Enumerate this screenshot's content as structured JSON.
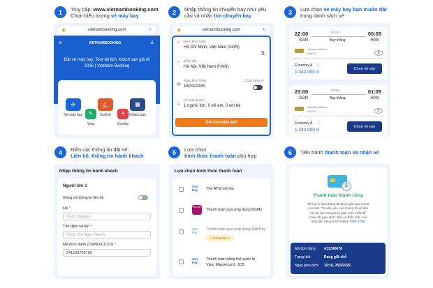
{
  "steps": [
    {
      "n": "1",
      "l1a": "Truy cập: ",
      "l1b": "www.vietnambooking.com",
      "l2a": "Chọn biểu tượng ",
      "l2b": "vé máy bay"
    },
    {
      "n": "2",
      "l1": "Nhập thông tin chuyến bay như yêu",
      "l2a": "cầu và nhấn ",
      "l2b": "tìm chuyến bay"
    },
    {
      "n": "3",
      "l1a": "Lựa chọn ",
      "l1b": "vé máy bay bạn muốn đặt",
      "l2": "trong danh sách vé"
    },
    {
      "n": "4",
      "l1": "Điền các thông tin đặt vé:",
      "l2": "Liên hệ, thông tin hành khách"
    },
    {
      "n": "5",
      "l1": "Lựa chọn",
      "l2a": "hình thức thanh toán",
      "l2b": " phù hợp"
    },
    {
      "n": "6",
      "l1a": "Tiến hành ",
      "l1b": "thanh toán và nhận vé"
    }
  ],
  "s1": {
    "url": "vietnambooking.com",
    "logo": "VIETNAMBOOKING",
    "banner1": "Đặt vé máy bay, Tour du lịch, khách sạn giá rẻ",
    "banner2": "2026 | VietNam Booking",
    "icons": [
      {
        "label": "Vé máy bay",
        "color": "#1a66d9"
      },
      {
        "label": "Du lịch",
        "color": "#e05a2a"
      },
      {
        "label": "Khách sạn",
        "color": "#2a4a8a"
      },
      {
        "label": "Visa",
        "color": "#25a86b"
      },
      {
        "label": "Combo",
        "color": "#e0404a"
      }
    ]
  },
  "s2": {
    "url": "vietnambooking.com",
    "from_label": "Điểm khởi hành",
    "from": "Hồ Chí Minh, Việt Nam (SGN)",
    "to_label": "Điểm đến",
    "to": "Hà Nội, Việt Nam (HAN)",
    "date_label": "Ngày khởi hành",
    "date": "18/03/2026",
    "return_label": "Chọn ngày về",
    "pax_label": "Số hành khách",
    "pax": "1 người lớn, 0 trẻ em, 0 em bé",
    "button": "TÌM CHUYẾN BAY"
  },
  "s3": {
    "flights": [
      {
        "dep": "22:00",
        "arr": "00:05",
        "dur": "2h 5m",
        "type": "Bay thẳng",
        "from": "SGN",
        "to": "HAN",
        "airline": "Vietnam Airlines",
        "code": "VN224",
        "class": "Economy A",
        "price": "1.342.000 đ",
        "button": "Chọn vé này",
        "bag": "0"
      },
      {
        "dep": "23:00",
        "arr": "01:05",
        "dur": "2h 5m",
        "type": "Bay thẳng",
        "from": "SGN",
        "to": "HAN",
        "airline": "Vietnam Airlines",
        "code": "VN276",
        "class": "Economy A",
        "price": "1.342.000 đ",
        "button": "Chọn vé này",
        "bag": "0"
      }
    ]
  },
  "s4": {
    "title": "Nhập thông tin hành khách",
    "pax": "Người lớn 1",
    "same": "Giống với thông tin liên hệ",
    "ho_label": "Họ",
    "ho_ph": "Ví dụ: Nguyen",
    "ten_label": "Tên đệm và tên",
    "ten_ph": "Ví dụ: Thi Ngoc Thanh",
    "id_label": "Mã định danh (CMND/CCCD)",
    "id_value": "241523768796",
    "required": "*"
  },
  "s5": {
    "title": "Lựa chọn hình thức thanh toán",
    "options": [
      {
        "logo": "One Pay",
        "label": "Thẻ ATM nội địa"
      },
      {
        "logo": "Mo Mo",
        "label": "Thanh toán qua ứng dụng MoMo"
      },
      {
        "logo": "Zalo Pay",
        "label": "Thanh toán qua ứng dụng ZaloPay",
        "tag": "Đang bảo trì"
      },
      {
        "logo": "One Pay",
        "label": "Thanh toán bằng thẻ quốc tế,",
        "label2": "Visa, Mastercard, JCB"
      }
    ]
  },
  "s6": {
    "success": "Thanh toán thành công",
    "desc": [
      "Thông tin đơn hàng đã được gửi qua email",
      "của bạn. Tư vấn viên của chúng tôi sẽ liên",
      "hệ với bạn trong thời gian sớm nhất để",
      "hoàn tất giao dịch. Nếu có thắc mắc, vui",
      "lòng liên hệ qua số hotline "
    ],
    "hotline": "1900 4796",
    "order_label": "Mã đơn hàng:",
    "order": "A12345678",
    "status_label": "Trạng thái:",
    "status": "Đang giữ chỗ",
    "time_label": "Ngày giao dịch:",
    "time": "10:16, 25/3/2026"
  }
}
